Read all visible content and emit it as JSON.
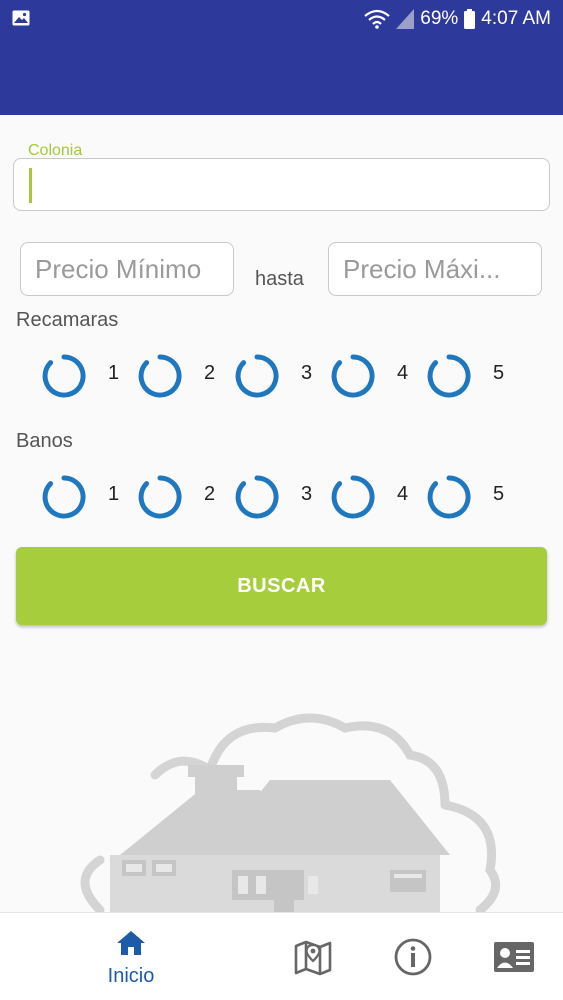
{
  "status_bar": {
    "battery_percent": "69%",
    "time": "4:07 AM",
    "icons": [
      "image-icon",
      "wifi-icon",
      "signal-icon",
      "battery-icon"
    ]
  },
  "form": {
    "colonia": {
      "label": "Colonia",
      "value": ""
    },
    "precio_minimo": {
      "placeholder": "Precio Mínimo"
    },
    "hasta_label": "hasta",
    "precio_maximo": {
      "placeholder": "Precio Máxi..."
    },
    "recamaras": {
      "label": "Recamaras",
      "options": [
        "1",
        "2",
        "3",
        "4",
        "5"
      ]
    },
    "banos": {
      "label": "Banos",
      "options": [
        "1",
        "2",
        "3",
        "4",
        "5"
      ]
    },
    "buscar_label": "BUSCAR"
  },
  "bottom_nav": {
    "items": [
      {
        "label": "Inicio",
        "icon": "home-icon",
        "active": true
      },
      {
        "label": "",
        "icon": "map-icon",
        "active": false
      },
      {
        "label": "",
        "icon": "info-icon",
        "active": false
      },
      {
        "label": "",
        "icon": "contact-card-icon",
        "active": false
      }
    ]
  },
  "colors": {
    "primary": "#2e3a9b",
    "accent_green": "#a6cd3c",
    "radio_blue": "#1f77bf",
    "nav_active": "#1d5ba8"
  }
}
